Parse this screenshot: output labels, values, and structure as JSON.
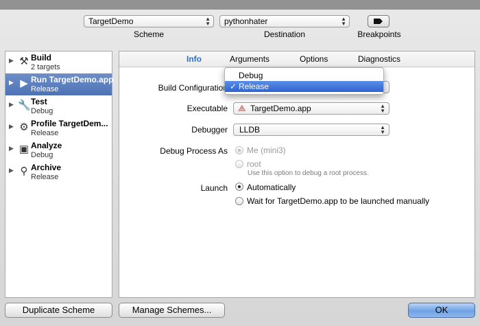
{
  "toolbar": {
    "scheme": {
      "value": "TargetDemo",
      "caption": "Scheme"
    },
    "destination": {
      "value": "pythonhater",
      "caption": "Destination"
    },
    "breakpoints": {
      "caption": "Breakpoints",
      "icon": "breakpoint-arrow-icon"
    }
  },
  "actions": [
    {
      "name": "Build",
      "sub": "2 targets",
      "icon": "hammer-icon",
      "selected": false
    },
    {
      "name": "Run TargetDemo.app",
      "sub": "Release",
      "icon": "play-icon",
      "selected": true
    },
    {
      "name": "Test",
      "sub": "Debug",
      "icon": "wrench-icon",
      "selected": false
    },
    {
      "name": "Profile TargetDem...",
      "sub": "Release",
      "icon": "profile-icon",
      "selected": false
    },
    {
      "name": "Analyze",
      "sub": "Debug",
      "icon": "analyze-icon",
      "selected": false
    },
    {
      "name": "Archive",
      "sub": "Release",
      "icon": "archive-icon",
      "selected": false
    }
  ],
  "tabs": {
    "info": "Info",
    "arguments": "Arguments",
    "options": "Options",
    "diagnostics": "Diagnostics"
  },
  "info": {
    "build_configuration": {
      "label": "Build Configuration"
    },
    "executable": {
      "label": "Executable",
      "value": "TargetDemo.app"
    },
    "debugger": {
      "label": "Debugger",
      "value": "LLDB"
    },
    "debug_process_as": {
      "label": "Debug Process As",
      "option_me": "Me (mini3)",
      "option_root": "root",
      "root_note": "Use this option to debug a root process."
    },
    "launch": {
      "label": "Launch",
      "option_auto": "Automatically",
      "option_wait": "Wait for TargetDemo.app to be launched manually"
    }
  },
  "menu": {
    "items": [
      {
        "label": "Debug",
        "checked": false
      },
      {
        "label": "Release",
        "checked": true,
        "check_mark": "✓"
      }
    ]
  },
  "buttons": {
    "duplicate": "Duplicate Scheme",
    "manage": "Manage Schemes...",
    "ok": "OK"
  },
  "colors": {
    "selection": "#4d72b5",
    "active_tab": "#2e6fbf",
    "menu_highlight": "#2f64d1"
  }
}
